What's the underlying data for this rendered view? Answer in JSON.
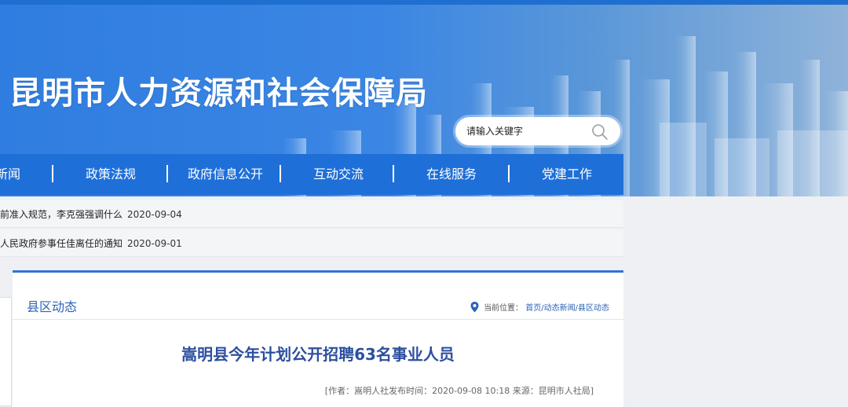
{
  "site": {
    "title": "昆明市人力资源和社会保障局"
  },
  "search": {
    "placeholder": "请输入关键字"
  },
  "nav": {
    "items": [
      "新闻",
      "政策法规",
      "政府信息公开",
      "互动交流",
      "在线服务",
      "党建工作"
    ]
  },
  "news_ticker": [
    {
      "text": "前准入规范，李克强强调什么",
      "date": "2020-09-04"
    },
    {
      "text": "人民政府参事任佳离任的通知",
      "date": "2020-09-01"
    }
  ],
  "article": {
    "section_title": "县区动态",
    "breadcrumb_label": "当前位置：",
    "breadcrumb_path": "首页/动态新闻/县区动态",
    "headline": "嵩明县今年计划公开招聘63名事业人员",
    "meta": "[作者：嵩明人社发布时间：2020-09-08 10:18 来源：昆明市人社局]"
  },
  "colors": {
    "nav_bg": "#1f6fd8",
    "accent": "#2e74d6",
    "headline": "#2c4f9e"
  },
  "icons": [
    "search-icon",
    "location-pin-icon"
  ]
}
